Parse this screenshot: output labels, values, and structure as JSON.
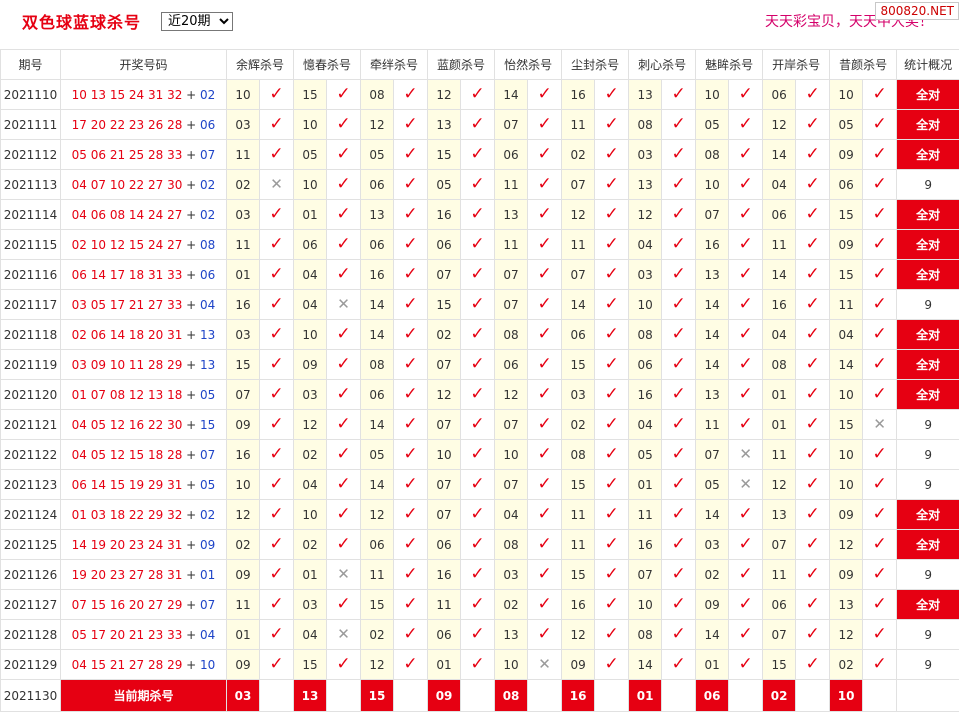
{
  "header": {
    "title": "双色球蓝球杀号",
    "period_select": "近20期",
    "slogan": "天天彩宝贝，天天中大奖！",
    "watermark": "800820.NET"
  },
  "columns": {
    "period": "期号",
    "draw": "开奖号码",
    "experts": [
      "余辉杀号",
      "憶春杀号",
      "牵绊杀号",
      "蓝颜杀号",
      "怡然杀号",
      "尘封杀号",
      "刺心杀号",
      "魅眸杀号",
      "开岸杀号",
      "昔颜杀号"
    ],
    "stat": "统计概况"
  },
  "rows": [
    {
      "period": "2021110",
      "red": "10 13 15 24 31 32",
      "blue": "02",
      "kills": [
        "10",
        "15",
        "08",
        "12",
        "14",
        "16",
        "13",
        "10",
        "06",
        "10"
      ],
      "marks": [
        1,
        1,
        1,
        1,
        1,
        1,
        1,
        1,
        1,
        1
      ],
      "stat": "全对"
    },
    {
      "period": "2021111",
      "red": "17 20 22 23 26 28",
      "blue": "06",
      "kills": [
        "03",
        "10",
        "12",
        "13",
        "07",
        "11",
        "08",
        "05",
        "12",
        "05"
      ],
      "marks": [
        1,
        1,
        1,
        1,
        1,
        1,
        1,
        1,
        1,
        1
      ],
      "stat": "全对"
    },
    {
      "period": "2021112",
      "red": "05 06 21 25 28 33",
      "blue": "07",
      "kills": [
        "11",
        "05",
        "05",
        "15",
        "06",
        "02",
        "03",
        "08",
        "14",
        "09"
      ],
      "marks": [
        1,
        1,
        1,
        1,
        1,
        1,
        1,
        1,
        1,
        1
      ],
      "stat": "全对"
    },
    {
      "period": "2021113",
      "red": "04 07 10 22 27 30",
      "blue": "02",
      "kills": [
        "02",
        "10",
        "06",
        "05",
        "11",
        "07",
        "13",
        "10",
        "04",
        "06"
      ],
      "marks": [
        0,
        1,
        1,
        1,
        1,
        1,
        1,
        1,
        1,
        1
      ],
      "stat": "9"
    },
    {
      "period": "2021114",
      "red": "04 06 08 14 24 27",
      "blue": "02",
      "kills": [
        "03",
        "01",
        "13",
        "16",
        "13",
        "12",
        "12",
        "07",
        "06",
        "15"
      ],
      "marks": [
        1,
        1,
        1,
        1,
        1,
        1,
        1,
        1,
        1,
        1
      ],
      "stat": "全对"
    },
    {
      "period": "2021115",
      "red": "02 10 12 15 24 27",
      "blue": "08",
      "kills": [
        "11",
        "06",
        "06",
        "06",
        "11",
        "11",
        "04",
        "16",
        "11",
        "09"
      ],
      "marks": [
        1,
        1,
        1,
        1,
        1,
        1,
        1,
        1,
        1,
        1
      ],
      "stat": "全对"
    },
    {
      "period": "2021116",
      "red": "06 14 17 18 31 33",
      "blue": "06",
      "kills": [
        "01",
        "04",
        "16",
        "07",
        "07",
        "07",
        "03",
        "13",
        "14",
        "15"
      ],
      "marks": [
        1,
        1,
        1,
        1,
        1,
        1,
        1,
        1,
        1,
        1
      ],
      "stat": "全对"
    },
    {
      "period": "2021117",
      "red": "03 05 17 21 27 33",
      "blue": "04",
      "kills": [
        "16",
        "04",
        "14",
        "15",
        "07",
        "14",
        "10",
        "14",
        "16",
        "11"
      ],
      "marks": [
        1,
        0,
        1,
        1,
        1,
        1,
        1,
        1,
        1,
        1
      ],
      "stat": "9"
    },
    {
      "period": "2021118",
      "red": "02 06 14 18 20 31",
      "blue": "13",
      "kills": [
        "03",
        "10",
        "14",
        "02",
        "08",
        "06",
        "08",
        "14",
        "04",
        "04"
      ],
      "marks": [
        1,
        1,
        1,
        1,
        1,
        1,
        1,
        1,
        1,
        1
      ],
      "stat": "全对"
    },
    {
      "period": "2021119",
      "red": "03 09 10 11 28 29",
      "blue": "13",
      "kills": [
        "15",
        "09",
        "08",
        "07",
        "06",
        "15",
        "06",
        "14",
        "08",
        "14"
      ],
      "marks": [
        1,
        1,
        1,
        1,
        1,
        1,
        1,
        1,
        1,
        1
      ],
      "stat": "全对"
    },
    {
      "period": "2021120",
      "red": "01 07 08 12 13 18",
      "blue": "05",
      "kills": [
        "07",
        "03",
        "06",
        "12",
        "12",
        "03",
        "16",
        "13",
        "01",
        "10"
      ],
      "marks": [
        1,
        1,
        1,
        1,
        1,
        1,
        1,
        1,
        1,
        1
      ],
      "stat": "全对"
    },
    {
      "period": "2021121",
      "red": "04 05 12 16 22 30",
      "blue": "15",
      "kills": [
        "09",
        "12",
        "14",
        "07",
        "07",
        "02",
        "04",
        "11",
        "01",
        "15"
      ],
      "marks": [
        1,
        1,
        1,
        1,
        1,
        1,
        1,
        1,
        1,
        0
      ],
      "stat": "9"
    },
    {
      "period": "2021122",
      "red": "04 05 12 15 18 28",
      "blue": "07",
      "kills": [
        "16",
        "02",
        "05",
        "10",
        "10",
        "08",
        "05",
        "07",
        "11",
        "10"
      ],
      "marks": [
        1,
        1,
        1,
        1,
        1,
        1,
        1,
        0,
        1,
        1
      ],
      "stat": "9"
    },
    {
      "period": "2021123",
      "red": "06 14 15 19 29 31",
      "blue": "05",
      "kills": [
        "10",
        "04",
        "14",
        "07",
        "07",
        "15",
        "01",
        "05",
        "12",
        "10"
      ],
      "marks": [
        1,
        1,
        1,
        1,
        1,
        1,
        1,
        0,
        1,
        1
      ],
      "stat": "9"
    },
    {
      "period": "2021124",
      "red": "01 03 18 22 29 32",
      "blue": "02",
      "kills": [
        "12",
        "10",
        "12",
        "07",
        "04",
        "11",
        "11",
        "14",
        "13",
        "09"
      ],
      "marks": [
        1,
        1,
        1,
        1,
        1,
        1,
        1,
        1,
        1,
        1
      ],
      "stat": "全对"
    },
    {
      "period": "2021125",
      "red": "14 19 20 23 24 31",
      "blue": "09",
      "kills": [
        "02",
        "02",
        "06",
        "06",
        "08",
        "11",
        "16",
        "03",
        "07",
        "12"
      ],
      "marks": [
        1,
        1,
        1,
        1,
        1,
        1,
        1,
        1,
        1,
        1
      ],
      "stat": "全对"
    },
    {
      "period": "2021126",
      "red": "19 20 23 27 28 31",
      "blue": "01",
      "kills": [
        "09",
        "01",
        "11",
        "16",
        "03",
        "15",
        "07",
        "02",
        "11",
        "09"
      ],
      "marks": [
        1,
        0,
        1,
        1,
        1,
        1,
        1,
        1,
        1,
        1
      ],
      "stat": "9"
    },
    {
      "period": "2021127",
      "red": "07 15 16 20 27 29",
      "blue": "07",
      "kills": [
        "11",
        "03",
        "15",
        "11",
        "02",
        "16",
        "10",
        "09",
        "06",
        "13"
      ],
      "marks": [
        1,
        1,
        1,
        1,
        1,
        1,
        1,
        1,
        1,
        1
      ],
      "stat": "全对"
    },
    {
      "period": "2021128",
      "red": "05 17 20 21 23 33",
      "blue": "04",
      "kills": [
        "01",
        "04",
        "02",
        "06",
        "13",
        "12",
        "08",
        "14",
        "07",
        "12"
      ],
      "marks": [
        1,
        0,
        1,
        1,
        1,
        1,
        1,
        1,
        1,
        1
      ],
      "stat": "9"
    },
    {
      "period": "2021129",
      "red": "04 15 21 27 28 29",
      "blue": "10",
      "kills": [
        "09",
        "15",
        "12",
        "01",
        "10",
        "09",
        "14",
        "01",
        "15",
        "02"
      ],
      "marks": [
        1,
        1,
        1,
        1,
        0,
        1,
        1,
        1,
        1,
        1
      ],
      "stat": "9"
    }
  ],
  "current": {
    "period": "2021130",
    "label": "当前期杀号",
    "kills": [
      "03",
      "13",
      "15",
      "09",
      "08",
      "16",
      "01",
      "06",
      "02",
      "10"
    ]
  }
}
